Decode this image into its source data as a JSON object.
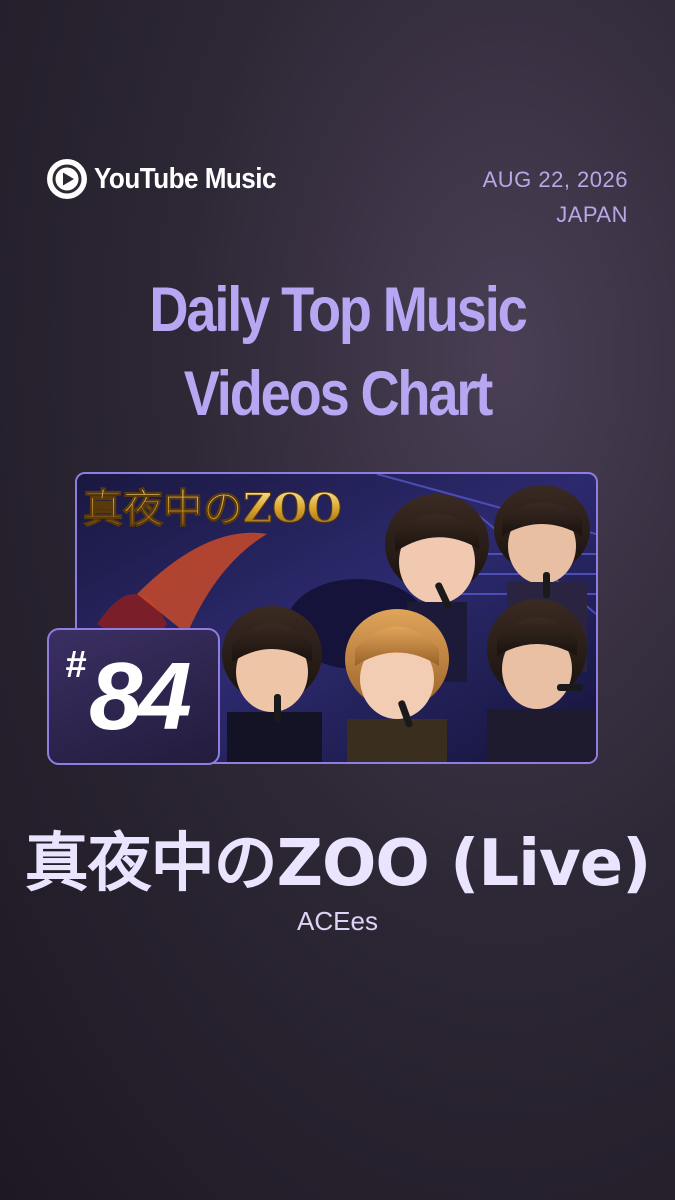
{
  "brand": {
    "name": "YouTube Music",
    "icon": "youtube-music-logo-icon"
  },
  "meta": {
    "date": "AUG 22, 2026",
    "region": "JAPAN"
  },
  "title": {
    "line1": "Daily Top Music",
    "line2": "Videos Chart"
  },
  "thumbnail": {
    "overlay_text": "真夜中のZOO"
  },
  "rank": {
    "hash": "#",
    "number": "84"
  },
  "song": {
    "title": "真夜中のZOO (Live)",
    "artist": "ACEes"
  },
  "colors": {
    "accent": "#b7a6f2",
    "border": "#8f7de0",
    "background": "#2e2836"
  }
}
